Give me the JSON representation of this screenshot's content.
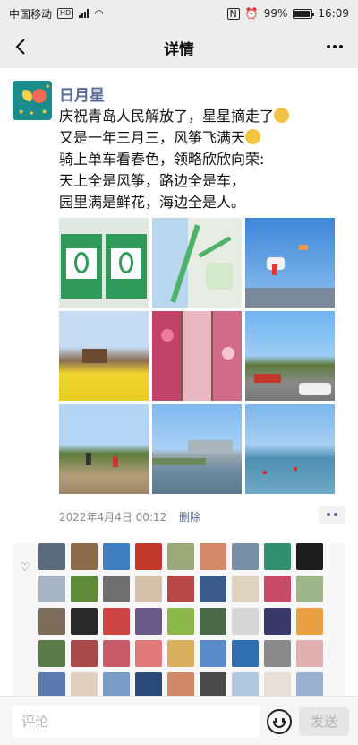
{
  "status_bar": {
    "carrier": "中国移动",
    "network": "HD",
    "battery": "99%",
    "time": "16:09"
  },
  "nav": {
    "title": "详情"
  },
  "post": {
    "nickname": "日月星",
    "lines": [
      "庆祝青岛人民解放了，星星摘走了",
      "又是一年三月三，风筝飞满天",
      "骑上单车看春色，领略欣欣向荣:",
      "天上全是风筝，路边全是车，",
      "园里满是鲜花，海边全是人。"
    ],
    "timestamp": "2022年4月4日 00:12",
    "delete_label": "删除",
    "photos": [
      {
        "name": "bike-ride-stats-photo"
      },
      {
        "name": "route-map-photo"
      },
      {
        "name": "kites-sky-photo"
      },
      {
        "name": "rapeseed-garden-photo"
      },
      {
        "name": "peach-blossom-photo"
      },
      {
        "name": "parking-lot-photo"
      },
      {
        "name": "park-people-photo"
      },
      {
        "name": "coastline-city-photo"
      },
      {
        "name": "beach-sea-photo"
      }
    ]
  },
  "likes": {
    "count": 45
  },
  "comment_bar": {
    "placeholder": "评论",
    "send_label": "发送"
  },
  "colors": {
    "link": "#576b95",
    "bar_bg": "#ededed"
  }
}
